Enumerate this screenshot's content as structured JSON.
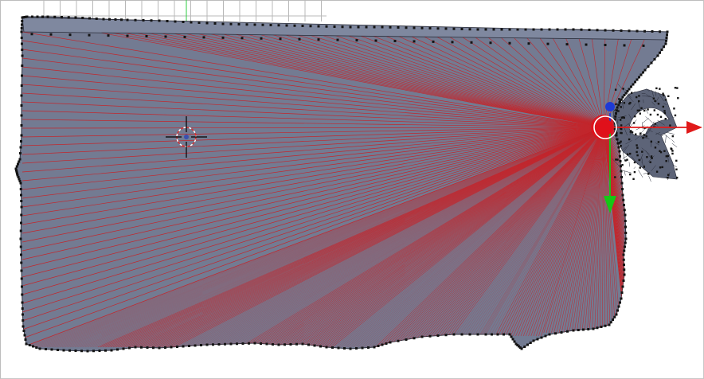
{
  "viewport": {
    "background": "#ffffff",
    "grid_color": "#b8b8b8",
    "grid_axis_color": "#2ecc40"
  },
  "mesh": {
    "fill": "#737b92",
    "edge_color": "#2a2d3a",
    "vertex_color": "#141414",
    "fan_edge_color": "#c2272d",
    "fan_center_color": "#e0101a"
  },
  "cursor_3d": {
    "icon": "3d-cursor-icon",
    "ring_color": "#d73232"
  },
  "manipulator": {
    "x_axis_color": "#e01a1a",
    "y_axis_color": "#16c616",
    "z_axis_color": "#1e3ad6",
    "icon": "transform-gizmo-icon"
  }
}
